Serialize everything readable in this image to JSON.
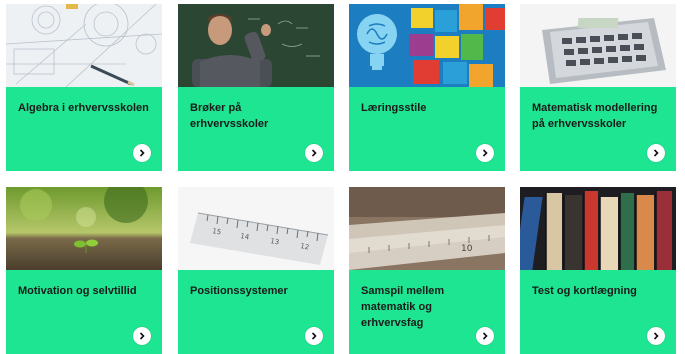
{
  "accent_color": "#1de592",
  "cards": [
    {
      "title": "Algebra i erhvervsskolen",
      "image": "compass-drawing-image",
      "icon": "chevron-right-icon"
    },
    {
      "title": "Brøker på erhvervsskoler",
      "image": "teacher-blackboard-image",
      "icon": "chevron-right-icon"
    },
    {
      "title": "Læringsstile",
      "image": "brain-puzzle-image",
      "icon": "chevron-right-icon"
    },
    {
      "title": "Matematisk modellering på erhvervsskoler",
      "image": "calculator-image",
      "icon": "chevron-right-icon"
    },
    {
      "title": "Motivation og selvtillid",
      "image": "sprout-image",
      "icon": "chevron-right-icon"
    },
    {
      "title": "Positionssystemer",
      "image": "ruler-image",
      "icon": "chevron-right-icon"
    },
    {
      "title": "Samspil mellem matematik og erhvervsfag",
      "image": "rulers-stack-image",
      "icon": "chevron-right-icon"
    },
    {
      "title": "Test og kortlægning",
      "image": "notebooks-image",
      "icon": "chevron-right-icon"
    }
  ]
}
